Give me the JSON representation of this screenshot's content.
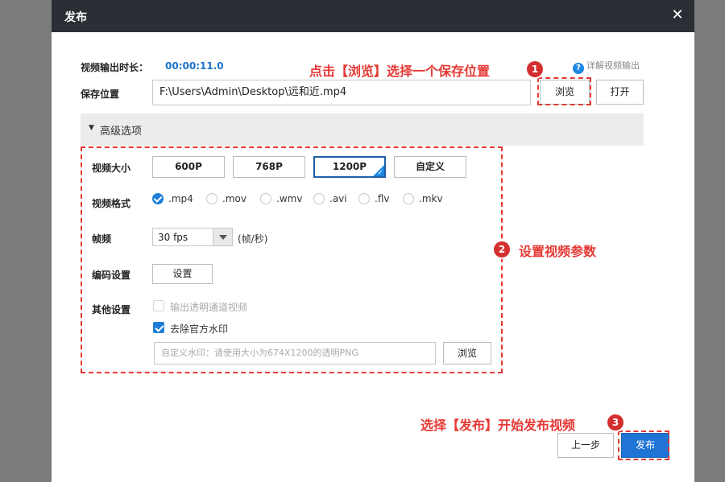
{
  "dialog": {
    "title": "发布"
  },
  "header": {
    "duration_label": "视频输出时长：",
    "duration_value": "00:00:11.0",
    "help_link": "详解视频输出"
  },
  "save": {
    "label": "保存位置",
    "path": "F:\\Users\\Admin\\Desktop\\远和近.mp4",
    "browse_label": "浏览",
    "open_label": "打开"
  },
  "advanced": {
    "label": "高级选项"
  },
  "video_size": {
    "label": "视频大小",
    "options": [
      "600P",
      "768P",
      "1200P",
      "自定义"
    ],
    "selected": "1200P"
  },
  "video_format": {
    "label": "视频格式",
    "options": [
      ".mp4",
      ".mov",
      ".wmv",
      ".avi",
      ".flv",
      ".mkv"
    ],
    "selected": ".mp4"
  },
  "framerate": {
    "label": "帧频",
    "value": "30 fps",
    "unit": "(帧/秒)"
  },
  "encoding": {
    "label": "编码设置",
    "button": "设置"
  },
  "other": {
    "label": "其他设置",
    "transparent_label": "输出透明通道视频",
    "remove_watermark_label": "去除官方水印",
    "watermark_placeholder": "自定义水印：请使用大小为674X1200的透明PNG",
    "watermark_browse": "浏览"
  },
  "footer": {
    "prev_label": "上一步",
    "publish_label": "发布"
  },
  "annotations": {
    "step1": "点击【浏览】选择一个保存位置",
    "step2": "设置视频参数",
    "step3": "选择【发布】开始发布视频",
    "badge1": "1",
    "badge2": "2",
    "badge3": "3"
  },
  "colors": {
    "accent": "#1f74d4",
    "annotation": "#e53935",
    "titlebar": "#2b2f35"
  }
}
